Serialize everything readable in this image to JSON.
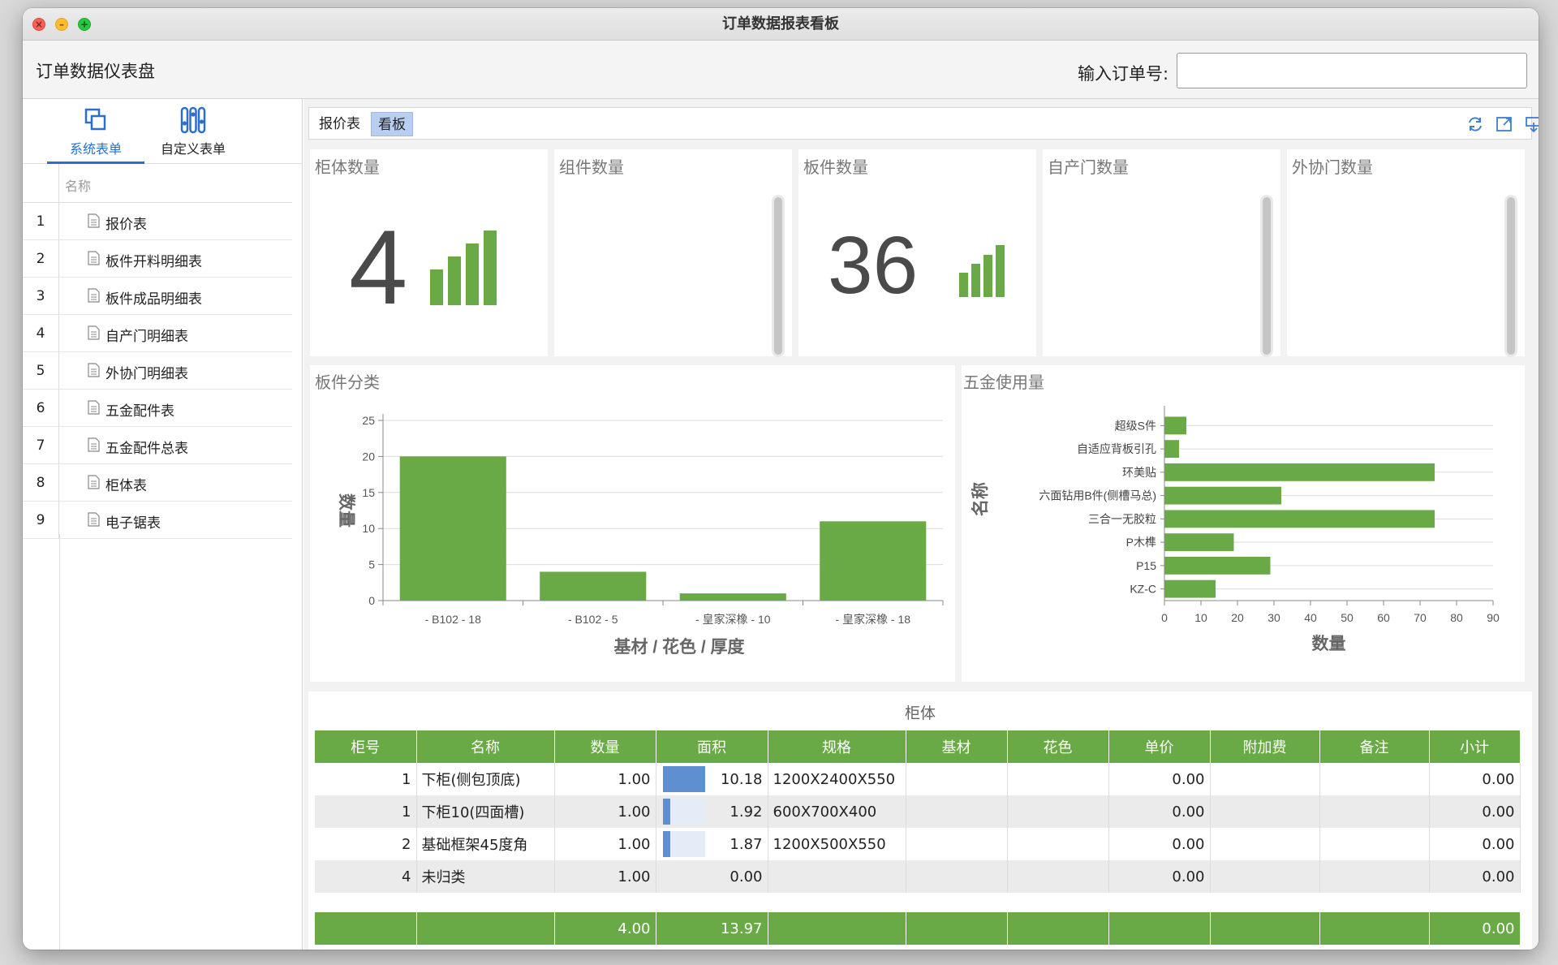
{
  "window": {
    "title": "订单数据报表看板"
  },
  "header": {
    "app_title": "订单数据仪表盘",
    "order_label": "输入订单号:",
    "order_value": ""
  },
  "sidebar": {
    "tabs": [
      {
        "label": "系统表单",
        "icon": "copy-icon"
      },
      {
        "label": "自定义表单",
        "icon": "sliders-icon"
      }
    ],
    "column_header": "名称",
    "items": [
      {
        "num": "1",
        "label": "报价表"
      },
      {
        "num": "2",
        "label": "板件开料明细表"
      },
      {
        "num": "3",
        "label": "板件成品明细表"
      },
      {
        "num": "4",
        "label": "自产门明细表"
      },
      {
        "num": "5",
        "label": "外协门明细表"
      },
      {
        "num": "6",
        "label": "五金配件表"
      },
      {
        "num": "7",
        "label": "五金配件总表"
      },
      {
        "num": "8",
        "label": "柜体表"
      },
      {
        "num": "9",
        "label": "电子锯表"
      }
    ]
  },
  "main": {
    "tabs": [
      {
        "label": "报价表"
      },
      {
        "label": "看板"
      }
    ],
    "toolbar_icons": [
      "refresh-icon",
      "expand-icon",
      "export-icon"
    ],
    "kpis": [
      {
        "title": "柜体数量",
        "value": "4"
      },
      {
        "title": "组件数量",
        "value": ""
      },
      {
        "title": "板件数量",
        "value": "36"
      },
      {
        "title": "自产门数量",
        "value": ""
      },
      {
        "title": "外协门数量",
        "value": ""
      }
    ],
    "colors": {
      "accent": "#6aaa46",
      "selected_tab": "#b8cff0",
      "area_bar": "#5f8fd0"
    }
  },
  "chart_data": [
    {
      "type": "bar",
      "title": "板件分类",
      "xlabel": "基材 / 花色 / 厚度",
      "ylabel": "数量",
      "categories": [
        "- B102 - 18",
        "- B102 - 5",
        "- 皇家深橡 - 10",
        "- 皇家深橡 - 18"
      ],
      "values": [
        20,
        4,
        1,
        11
      ],
      "ylim": [
        0,
        25
      ],
      "yticks": [
        0,
        5,
        10,
        15,
        20,
        25
      ],
      "grid": true,
      "color": "#6aaa46"
    },
    {
      "type": "bar",
      "orientation": "horizontal",
      "title": "五金使用量",
      "xlabel": "数量",
      "ylabel": "名称",
      "categories": [
        "超级S件",
        "自适应背板引孔",
        "环美贴",
        "六面钻用B件(侧槽马总)",
        "三合一无胶粒",
        "P木榫",
        "P15",
        "KZ-C"
      ],
      "values": [
        6,
        4,
        74,
        32,
        74,
        19,
        29,
        14
      ],
      "xlim": [
        0,
        90
      ],
      "xticks": [
        0,
        10,
        20,
        30,
        40,
        50,
        60,
        70,
        80,
        90
      ],
      "grid": true,
      "color": "#6aaa46"
    }
  ],
  "grid": {
    "title": "柜体",
    "columns": [
      "柜号",
      "名称",
      "数量",
      "面积",
      "规格",
      "基材",
      "花色",
      "单价",
      "附加费",
      "备注",
      "小计"
    ],
    "rows": [
      {
        "no": "1",
        "name": "下柜(侧包顶底)",
        "qty": "1.00",
        "area": "10.18",
        "area_frac": 1.0,
        "spec": "1200X2400X550",
        "base": "",
        "color": "",
        "price": "0.00",
        "extra": "",
        "note": "",
        "subtotal": "0.00"
      },
      {
        "no": "1",
        "name": "下柜10(四面槽)",
        "qty": "1.00",
        "area": "1.92",
        "area_frac": 0.19,
        "spec": "600X700X400",
        "base": "",
        "color": "",
        "price": "0.00",
        "extra": "",
        "note": "",
        "subtotal": "0.00"
      },
      {
        "no": "2",
        "name": "基础框架45度角",
        "qty": "1.00",
        "area": "1.87",
        "area_frac": 0.18,
        "spec": "1200X500X550",
        "base": "",
        "color": "",
        "price": "0.00",
        "extra": "",
        "note": "",
        "subtotal": "0.00"
      },
      {
        "no": "4",
        "name": "未归类",
        "qty": "1.00",
        "area": "0.00",
        "area_frac": 0,
        "spec": "",
        "base": "",
        "color": "",
        "price": "0.00",
        "extra": "",
        "note": "",
        "subtotal": "0.00"
      }
    ],
    "total": {
      "qty": "4.00",
      "area": "13.97",
      "subtotal": "0.00"
    }
  }
}
